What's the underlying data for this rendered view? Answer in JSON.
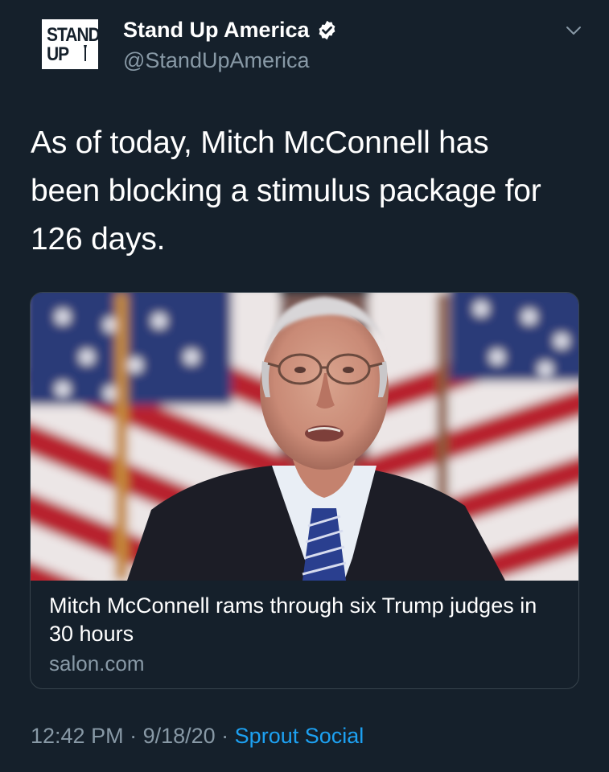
{
  "account": {
    "avatar_text_line1": "STAND",
    "avatar_text_line2": "UP",
    "display_name": "Stand Up America",
    "handle": "@StandUpAmerica",
    "verified_icon": "verified-badge-icon"
  },
  "menu": {
    "icon": "chevron-down-icon"
  },
  "tweet": {
    "text": "As of today, Mitch McConnell has\nbeen blocking a stimulus package for\n126 days."
  },
  "card": {
    "image_alt": "photo of Mitch McConnell in front of American flags",
    "title": "Mitch McConnell rams through six Trump judges in 30 hours",
    "domain": "salon.com"
  },
  "meta": {
    "time": "12:42 PM",
    "separator1": " · ",
    "date": "9/18/20",
    "separator2": " · ",
    "source": "Sprout Social"
  },
  "colors": {
    "background": "#15202b",
    "text_primary": "#ffffff",
    "text_secondary": "#8899a6",
    "accent": "#1da1f2",
    "border": "#38444d"
  }
}
